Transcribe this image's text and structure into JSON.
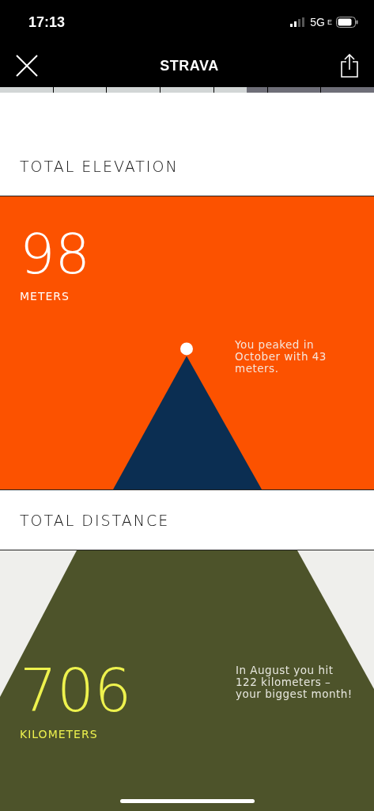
{
  "status_bar": {
    "time": "17:13",
    "network": "5G",
    "network_suffix": "E"
  },
  "nav": {
    "title": "STRAVA"
  },
  "progress": {
    "level": 0.66
  },
  "sections": [
    {
      "heading": "TOTAL ELEVATION",
      "kind": "peak",
      "value": "98",
      "unit": "METERS",
      "note": "You peaked in October with 43 meters."
    },
    {
      "heading": "TOTAL DISTANCE",
      "kind": "road",
      "value": "706",
      "unit": "KILOMETERS",
      "note": "In August you hit 122 kilometers – your biggest month!"
    }
  ]
}
